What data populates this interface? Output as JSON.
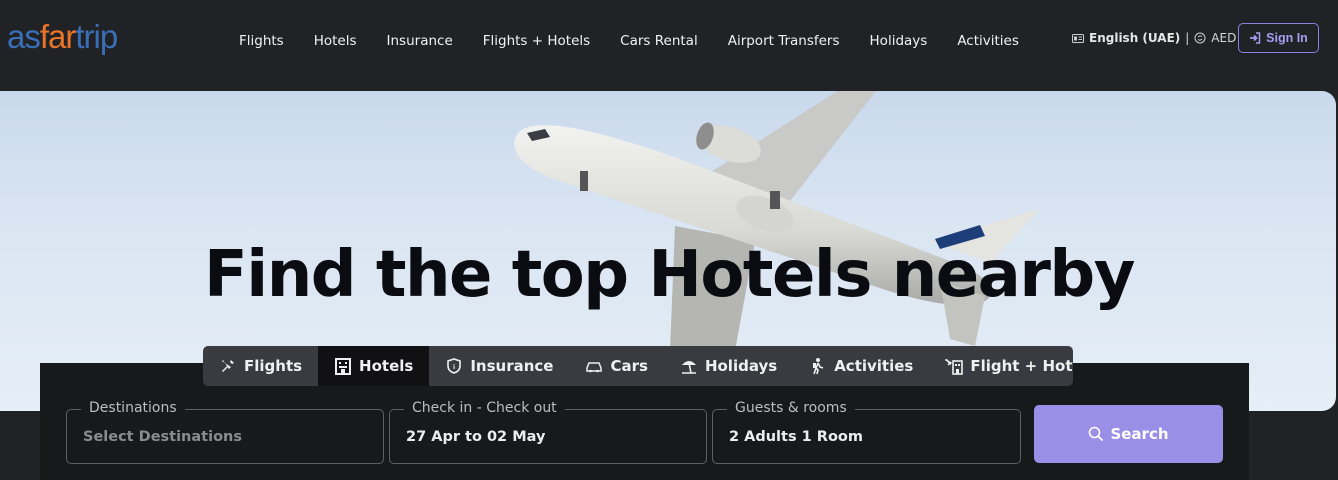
{
  "header": {
    "logo": {
      "part1": "as",
      "part2": "far",
      "part3": "trip"
    },
    "nav": [
      "Flights",
      "Hotels",
      "Insurance",
      "Flights + Hotels",
      "Cars Rental",
      "Airport Transfers",
      "Holidays",
      "Activities"
    ],
    "language": "English (UAE)",
    "separator": "|",
    "currency": "AED",
    "sign_in": "Sign In"
  },
  "hero": {
    "title": "Find the top Hotels nearby"
  },
  "tabs": [
    {
      "label": "Flights",
      "icon": "plane-icon",
      "active": false
    },
    {
      "label": "Hotels",
      "icon": "hotel-icon",
      "active": true
    },
    {
      "label": "Insurance",
      "icon": "shield-icon",
      "active": false
    },
    {
      "label": "Cars",
      "icon": "car-icon",
      "active": false
    },
    {
      "label": "Holidays",
      "icon": "beach-icon",
      "active": false
    },
    {
      "label": "Activities",
      "icon": "hiker-icon",
      "active": false
    },
    {
      "label": "Flight + Hotel",
      "icon": "plane-hotel-icon",
      "active": false
    }
  ],
  "search": {
    "destinations": {
      "legend": "Destinations",
      "placeholder": "Select Destinations"
    },
    "dates": {
      "legend": "Check in - Check out",
      "value": "27 Apr to 02 May"
    },
    "guests": {
      "legend": "Guests & rooms",
      "value": "2 Adults 1 Room"
    },
    "button": "Search"
  },
  "colors": {
    "accent": "#9a8ee6",
    "logo_blue": "#3a6fb7",
    "logo_orange": "#e9742a",
    "bg": "#212226"
  }
}
